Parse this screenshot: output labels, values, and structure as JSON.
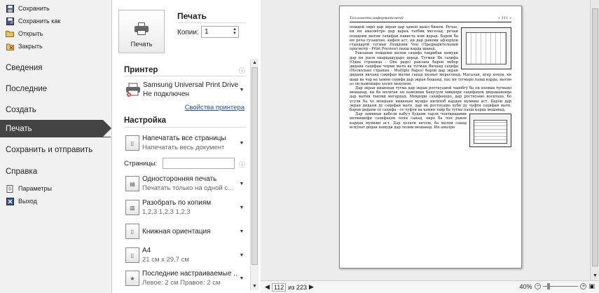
{
  "nav": {
    "top_items": [
      {
        "label": "Сохранить",
        "icon": "save-icon"
      },
      {
        "label": "Сохранить как",
        "icon": "save-as-icon"
      },
      {
        "label": "Открыть",
        "icon": "open-folder-icon"
      },
      {
        "label": "Закрыть",
        "icon": "close-document-icon"
      }
    ],
    "info": "Сведения",
    "recent": "Последние",
    "create": "Создать",
    "print": "Печать",
    "save_send": "Сохранить и отправить",
    "help": "Справка",
    "options": "Параметры",
    "exit": "Выход"
  },
  "print_panel": {
    "title": "Печать",
    "button_label": "Печать",
    "copies_label": "Копии:",
    "copies_value": "1",
    "printer_section": "Принтер",
    "printer_name": "Samsung Universal Print Driver",
    "printer_status": "Не подключен",
    "printer_props": "Свойства принтера",
    "settings_section": "Настройка",
    "settings": [
      {
        "l1": "Напечатать все страницы",
        "l2": "Напечатать весь документ"
      },
      {
        "l1": "Односторонняя печать",
        "l2": "Печатать только на одной с..."
      },
      {
        "l1": "Разобрать по копиям",
        "l2": "1,2,3    1,2,3    1,2,3"
      },
      {
        "l1": "Книжная ориентация",
        "l2": ""
      },
      {
        "l1": "A4",
        "l2": "21 см x 29,7 см"
      },
      {
        "l1": "Последние настраиваемые ...",
        "l2": "Левое: 2 см   Правое: 2 см"
      }
    ],
    "pages_label": "Страницы:"
  },
  "preview": {
    "header_left": "Таълимоти информатсионӣ",
    "header_right": "« 111 »",
    "para1": "пешдоӣ оиро дар экран дар ҳамон шакл бинем. Речае, ки ин амалиётро дар вараъ татбиқ месозад, речаи пешдоии матни саҳифаи нависта ном дорад. Барои ба ин реча гузаштан, кифоя аст, ки дар давоми афзорҳои стандартӣ тугмаи Пешдоии Чоп (Предварительный просмотр - Print Preview) пахш карда шавад.",
    "para2": "Равзанаи пешдоии матни саҳифа тақрибан намуди дар ин расм овардашударо дорад. Тугмаи Як саҳифа (Одна страница - One page) равзана барои якбор дидани саҳифаи чории матн ва тугмаи Якчанд саҳифа (Несколько страниц - Multiple Pages) барои дар экран дидани якчанд саҳифаи матни санад хизмат мерасонад. Масалан, агар хоҳем, ки шаш ва чор ва ҳамон саҳифа дар экран бошанд, пас ин тугмаро пахш карда, матни аз он намоишро ҳосил мекунем.",
    "para3": "Дар экран нишонаи тугма дар экран ростнуамоӣ чавобгӯ ба он иловаи тугмаҳо мешавад, ки ба воситаи он намоиши бахусуси миқдори саҳифаҳои дидашаванда дар матни тавлид мегардад. Миқдори саҳифаҳоро, дар ростнуамо воситаҳо, бо усули ба ҷо мондани нишонаи мушро интихоб кардан мумкин аст. Барои дар экран дидани ду саҳифаи матн, дар як ростнуамо хуби ду чуфти саҳифаи матн, барои дидани се саҳифа - се чуфти ва ҳамин тавр ба тугма пахш карда мешавад.",
    "para4": "Дар замимаи кабели кабул будани тарзи чоитқишавии инткишофи сахифаҳои чопи санад, оиро ба чоп равон кардан мумкин аст. Дар ҳолати анҷом, ба матни санад искӯнат додан намуди дар лозим мешавад. Ин амалро",
    "current_page": "112",
    "page_of": "из 223",
    "zoom_percent": "40%"
  }
}
